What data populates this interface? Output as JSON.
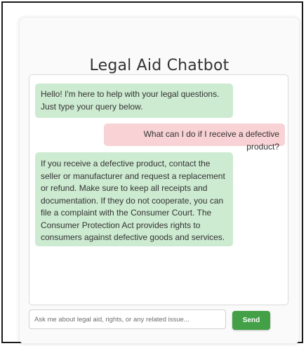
{
  "app": {
    "title": "Legal Aid Chatbot"
  },
  "chat": {
    "messages": [
      {
        "sender": "bot",
        "text": "Hello! I'm here to help with your legal questions. Just type your query below."
      },
      {
        "sender": "user",
        "text": "What can I do if I receive a defective product?"
      },
      {
        "sender": "bot",
        "text": "If you receive a defective product, contact the seller or manufacturer and request a replacement or refund. Make sure to keep all receipts and documentation. If they do not cooperate, you can file a complaint with the Consumer Court. The Consumer Protection Act provides rights to consumers against defective goods and services."
      }
    ]
  },
  "composer": {
    "placeholder": "Ask me about legal aid, rights, or any related issue...",
    "value": "",
    "send_label": "Send"
  },
  "colors": {
    "bot_bubble": "#cdebd1",
    "user_bubble": "#f8d2d4",
    "send_button": "#43a047",
    "title_text": "#333333"
  }
}
